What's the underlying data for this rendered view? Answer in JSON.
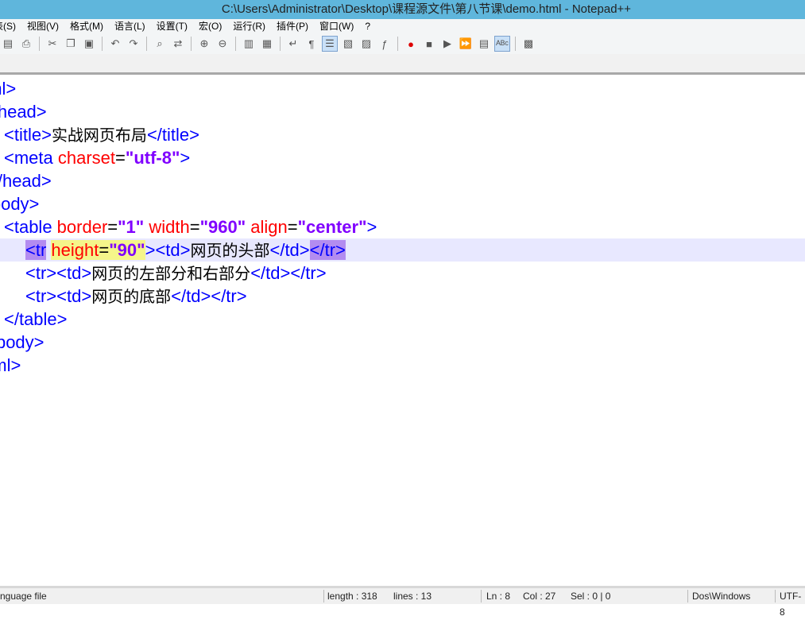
{
  "window": {
    "title": "C:\\Users\\Administrator\\Desktop\\课程源文件\\第八节课\\demo.html - Notepad++"
  },
  "menu": [
    "表(S)",
    "视图(V)",
    "格式(M)",
    "语言(L)",
    "设置(T)",
    "宏(O)",
    "运行(R)",
    "插件(P)",
    "窗口(W)",
    "?"
  ],
  "toolbar": [
    "new-icon",
    "print-icon",
    "cut-icon",
    "copy-icon",
    "paste-icon",
    "undo-icon",
    "redo-icon",
    "find-icon",
    "replace-icon",
    "zoom-in-icon",
    "zoom-out-icon",
    "sync-v-icon",
    "sync-h-icon",
    "word-wrap-icon",
    "show-all-chars-icon",
    "indent-guide-icon",
    "doc-map-icon",
    "function-list-icon",
    "folder-icon",
    "record-macro-icon",
    "stop-record-icon",
    "play-macro-icon",
    "run-multiple-icon",
    "save-macro-icon",
    "spellcheck-icon",
    "plugin-icon"
  ],
  "code": [
    {
      "segs": [
        [
          "t",
          "<html>"
        ]
      ]
    },
    {
      "segs": [
        [
          "t",
          "<head>"
        ]
      ]
    },
    {
      "segs": [
        [
          "t",
          "<title>"
        ],
        [
          "x",
          "实战网页布局"
        ],
        [
          "t",
          "</title>"
        ]
      ]
    },
    {
      "segs": [
        [
          "t",
          "<meta "
        ],
        [
          "a",
          "charset"
        ],
        [
          "eq",
          "="
        ],
        [
          "v",
          "\"utf-8\""
        ],
        [
          "t",
          ">"
        ]
      ]
    },
    {
      "segs": [
        [
          "t",
          "</head>"
        ]
      ]
    },
    {
      "segs": [
        [
          "t",
          "<body>"
        ]
      ]
    },
    {
      "segs": [
        [
          "t",
          "<table "
        ],
        [
          "a",
          "border"
        ],
        [
          "eq",
          "="
        ],
        [
          "v",
          "\"1\""
        ],
        [
          "a",
          " width"
        ],
        [
          "eq",
          "="
        ],
        [
          "v",
          "\"960\""
        ],
        [
          "a",
          " align"
        ],
        [
          "eq",
          "="
        ],
        [
          "v",
          "\"center\""
        ],
        [
          "t",
          ">"
        ]
      ]
    },
    {
      "segs": [
        [
          "t m",
          "<tr"
        ],
        [
          "t",
          " "
        ],
        [
          "a hy",
          "height"
        ],
        [
          "eq hy",
          "="
        ],
        [
          "v hy",
          "\"90\""
        ],
        [
          "t",
          ">"
        ],
        [
          "t",
          "<td>"
        ],
        [
          "x",
          "网页的头部"
        ],
        [
          "t",
          "</td>"
        ],
        [
          "t m",
          "</tr>"
        ]
      ]
    },
    {
      "segs": [
        [
          "t",
          "<tr><td>"
        ],
        [
          "x",
          "网页的左部分和右部分"
        ],
        [
          "t",
          "</td></tr>"
        ]
      ]
    },
    {
      "segs": [
        [
          "t",
          "<tr><td>"
        ],
        [
          "x",
          "网页的底部"
        ],
        [
          "t",
          "</td></tr>"
        ]
      ]
    },
    {
      "segs": [
        [
          "t",
          "</table>"
        ]
      ]
    },
    {
      "segs": [
        [
          "t",
          "</body>"
        ]
      ]
    },
    {
      "segs": [
        [
          "t",
          "</html>"
        ]
      ]
    }
  ],
  "status": {
    "type": "nguage file",
    "length": "length : 318",
    "lines": "lines : 13",
    "ln": "Ln : 8",
    "col": "Col : 27",
    "sel": "Sel : 0 | 0",
    "eol": "Dos\\Windows",
    "enc": "UTF-8"
  }
}
